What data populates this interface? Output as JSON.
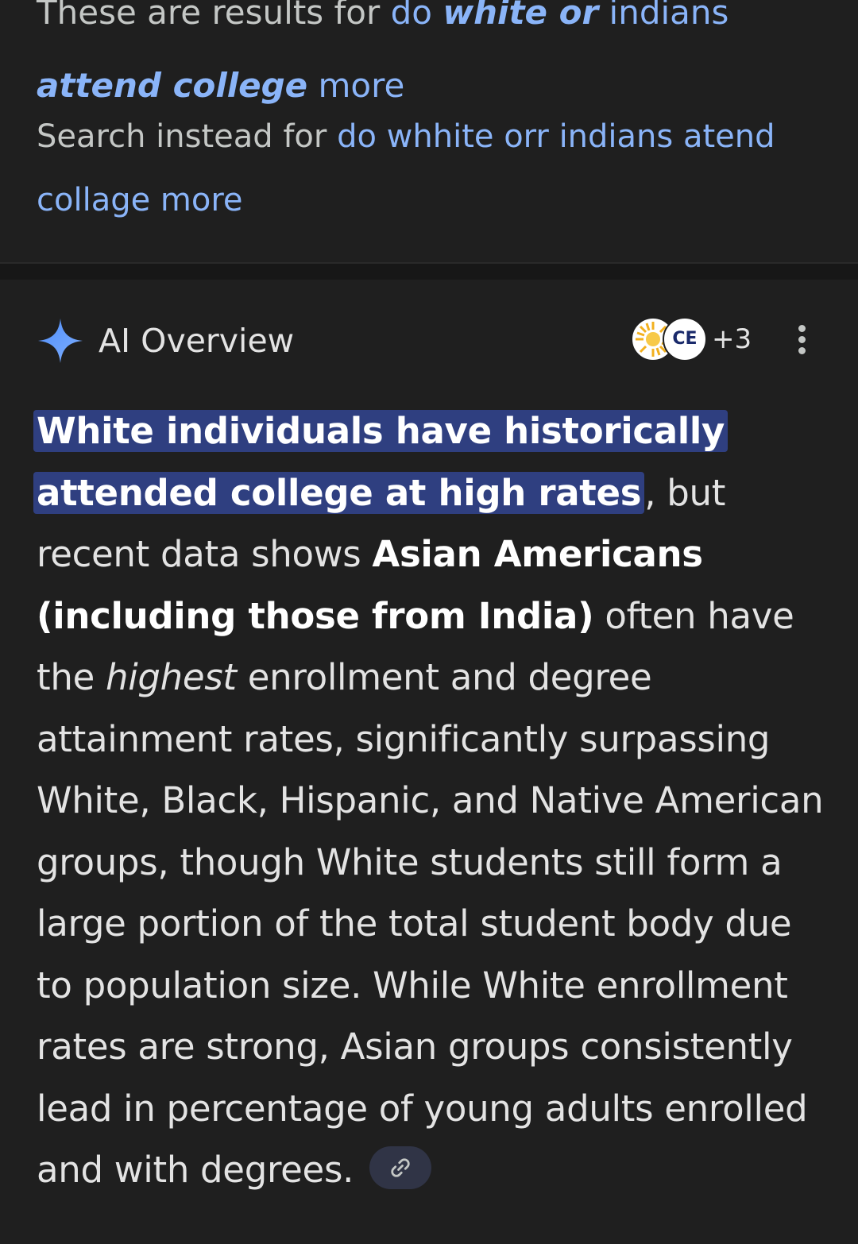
{
  "spelling": {
    "results_prefix": "These are results for ",
    "corrected_plain_1": "do ",
    "corrected_bold_1": "white or",
    "corrected_plain_2": " indians ",
    "corrected_bold_2": "attend college",
    "corrected_plain_3": " more",
    "instead_prefix": "Search instead for ",
    "original_query": "do whhite orr indians atend collage more"
  },
  "ai_overview": {
    "title": "AI Overview",
    "source_badge_2": "CE",
    "more_sources": "+3",
    "highlighted": "White individuals have historically attended college at high rates",
    "text_1": ", but recent data shows ",
    "bold_1": "Asian Americans (including those from India)",
    "text_2": " often have the ",
    "italic_1": "highest",
    "text_3": " enrollment and degree attainment rates, significantly surpassing White, Black, Hispanic, and Native American groups, though White students still form a large portion of the total student body due to population size. While White enrollment rates are strong, Asian groups consistently lead in percentage of young adults enrolled and with degrees. "
  },
  "icons": {
    "sparkle": "sparkle-icon",
    "more": "more-vert-icon",
    "link": "link-icon"
  },
  "colors": {
    "link": "#8ab4f8",
    "highlight": "#2f3f80",
    "background": "#1f1f1f"
  }
}
